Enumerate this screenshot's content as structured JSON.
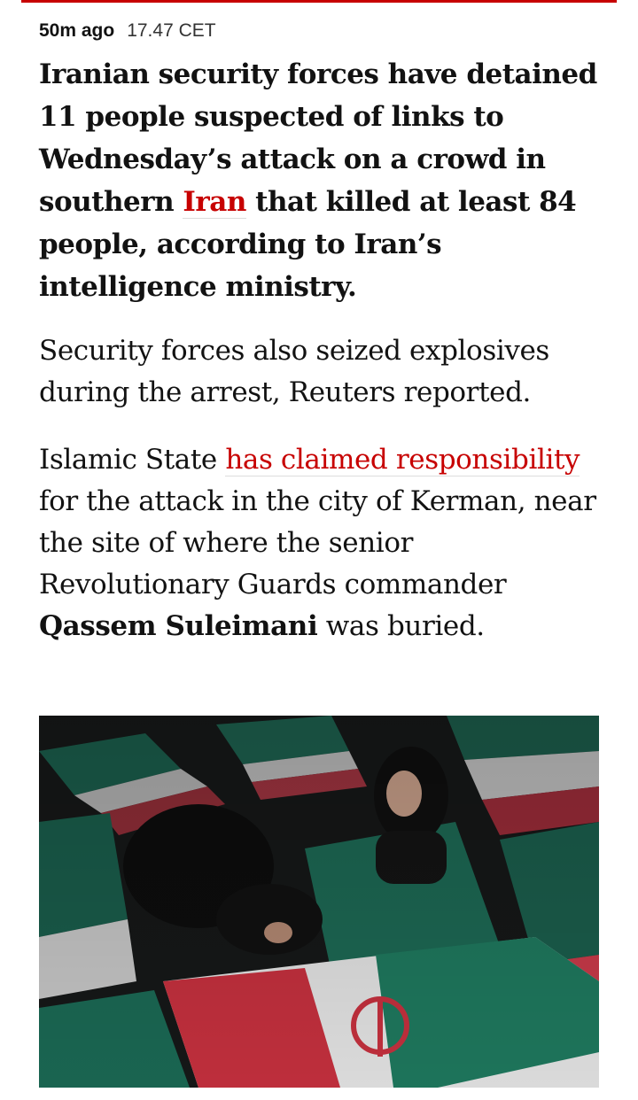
{
  "article": {
    "timestamp_relative": "50m ago",
    "timestamp_absolute": "17.47 CET",
    "headline_part1": "Iranian security forces have detained 11 people suspected of links to Wednesday’s attack on a crowd in southern ",
    "headline_link": "Iran",
    "headline_part2": " that killed at least 84 people, according to Iran’s intelligence ministry.",
    "paragraph1": "Security forces also seized explosives during the arrest, Reuters reported.",
    "paragraph2_part1": "Islamic State ",
    "paragraph2_link": "has claimed responsibility",
    "paragraph2_part2": " for the attack in the city of Kerman, near the site of where the senior Revolutionary Guards commander ",
    "paragraph2_bold": "Qassem Suleimani",
    "paragraph2_part3": " was buried."
  },
  "colors": {
    "accent_red": "#c70000",
    "text": "#121212"
  },
  "icons": []
}
